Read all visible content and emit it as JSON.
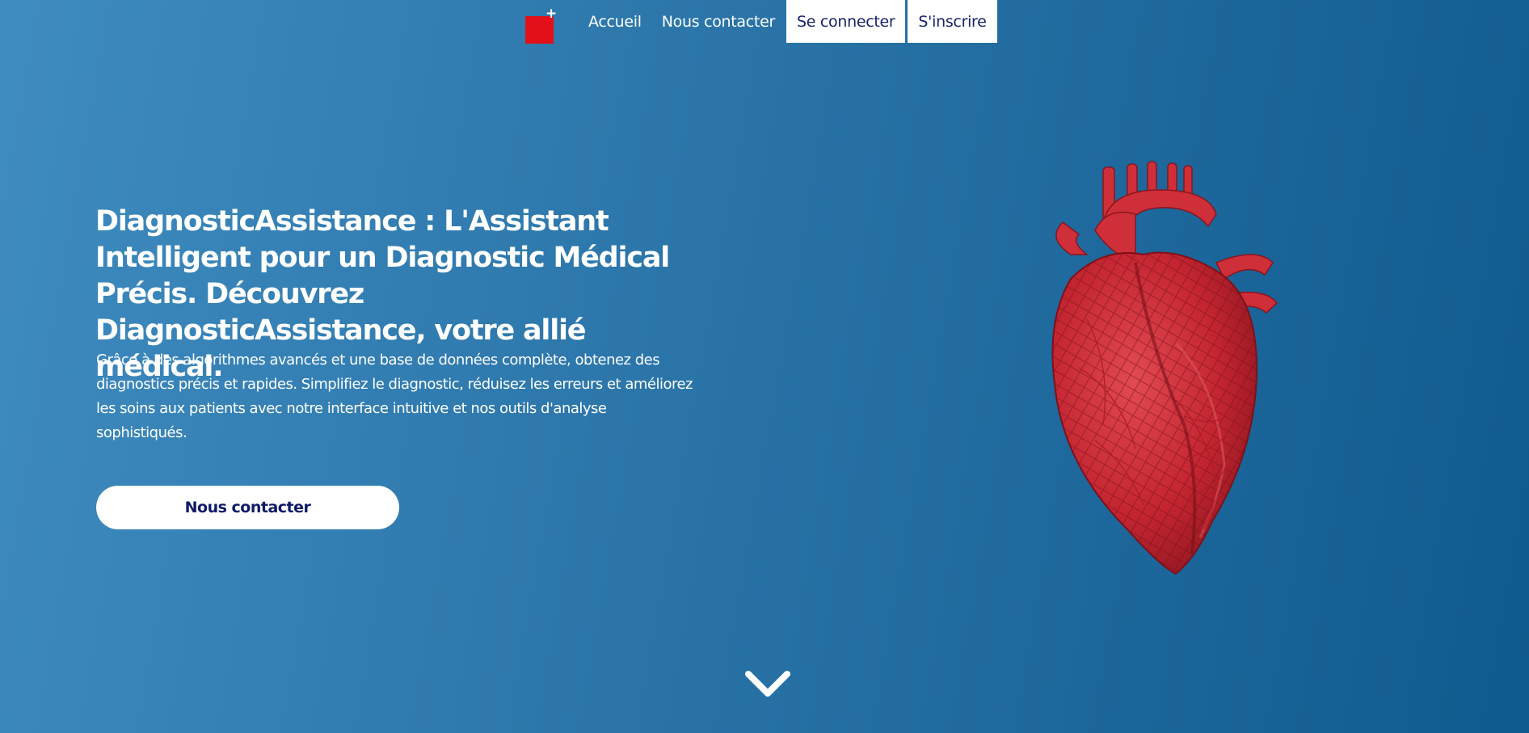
{
  "nav": {
    "logo_plus": "+",
    "links": {
      "home": "Accueil",
      "contact": "Nous contacter"
    },
    "buttons": {
      "login": "Se connecter",
      "signup": "S'inscrire"
    }
  },
  "hero": {
    "title": "DiagnosticAssistance : L'Assistant Intelligent pour un Diagnostic Médical Précis. Découvrez DiagnosticAssistance, votre allié médical.",
    "description": "Grâce à des algorithmes avancés et une base de données complète, obtenez des diagnostics précis et rapides. Simplifiez le diagnostic, réduisez les erreurs et améliorez les soins aux patients avec notre interface intuitive et nos outils d'analyse sophistiqués.",
    "cta_label": "Nous contacter"
  },
  "icons": {
    "logo": "medical-cross-logo-icon",
    "scroll": "chevron-down-icon",
    "illustration": "anatomical-heart-image"
  },
  "colors": {
    "logo_red": "#e3101a",
    "button_text": "#16226a",
    "background_start": "#3f8cc0",
    "background_end": "#0f5a8e",
    "heart_red": "#d42a34"
  }
}
